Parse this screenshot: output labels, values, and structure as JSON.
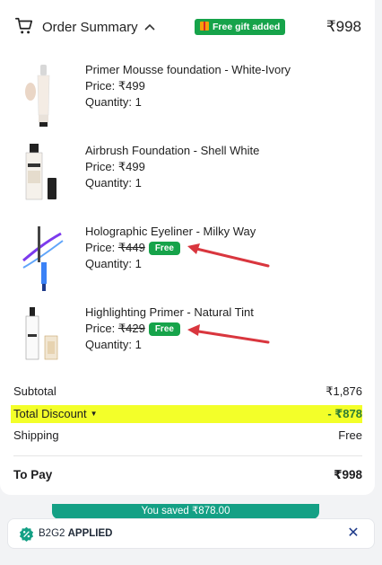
{
  "header": {
    "title": "Order Summary",
    "gift_badge": "Free gift added",
    "total": "₹998"
  },
  "items": [
    {
      "name": "Primer Mousse foundation - White-Ivory",
      "price_label": "Price: ",
      "price": "₹499",
      "qty": "Quantity: 1",
      "free": ""
    },
    {
      "name": "Airbrush Foundation - Shell White",
      "price_label": "Price: ",
      "price": "₹499",
      "qty": "Quantity: 1",
      "free": ""
    },
    {
      "name": "Holographic Eyeliner - Milky Way",
      "price_label": "Price: ",
      "price": "₹449",
      "qty": "Quantity: 1",
      "free": "Free"
    },
    {
      "name": "Highlighting Primer - Natural Tint",
      "price_label": "Price: ",
      "price": "₹429",
      "qty": "Quantity: 1",
      "free": "Free"
    }
  ],
  "summary": {
    "subtotal_label": "Subtotal",
    "subtotal": "₹1,876",
    "discount_label": "Total Discount",
    "discount": "- ₹878",
    "shipping_label": "Shipping",
    "shipping": "Free",
    "topay_label": "To Pay",
    "topay": "₹998"
  },
  "savings": {
    "text": "You saved ₹878.00"
  },
  "coupon": {
    "code": "B2G2",
    "status": "APPLIED"
  },
  "colors": {
    "accent_green": "#16a34a",
    "teal": "#14a085",
    "highlight": "#f3ff29",
    "arrow_red": "#d9363e"
  }
}
